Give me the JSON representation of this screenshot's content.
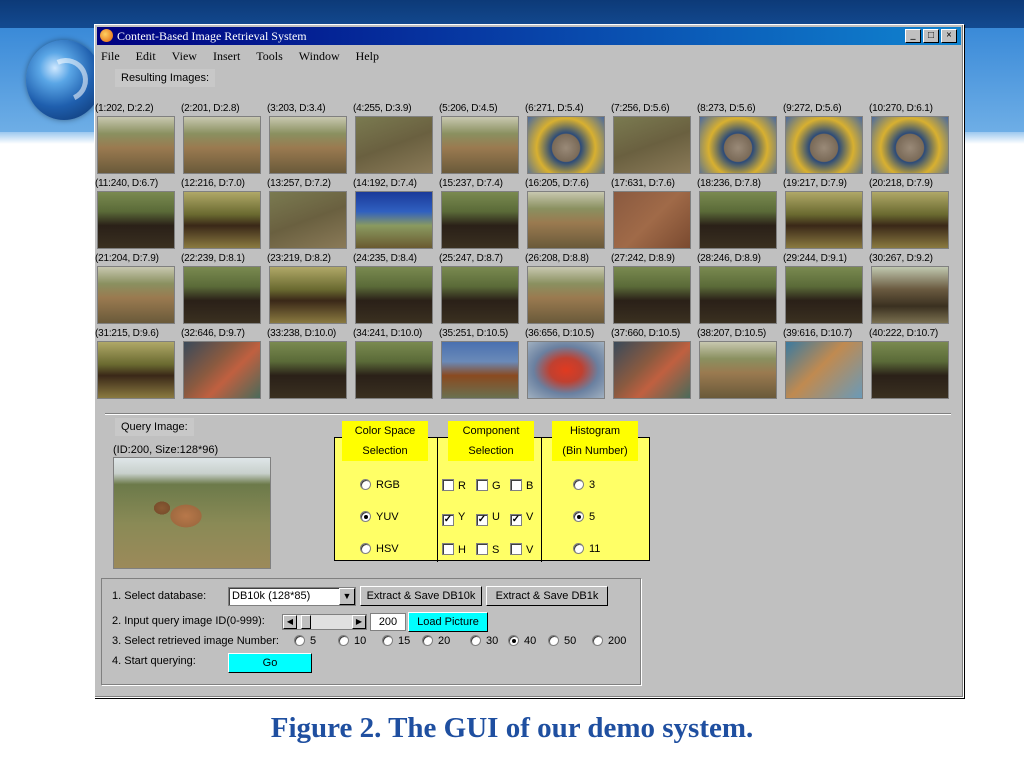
{
  "window": {
    "title": "Content-Based Image Retrieval System",
    "buttons": [
      "_",
      "□",
      "×"
    ]
  },
  "menu": [
    "File",
    "Edit",
    "View",
    "Insert",
    "Tools",
    "Window",
    "Help"
  ],
  "results_label": "Resulting Images:",
  "results": [
    {
      "cap": "(1:202, D:2.2)",
      "tone": "elk"
    },
    {
      "cap": "(2:201, D:2.8)",
      "tone": "elk"
    },
    {
      "cap": "(3:203, D:3.4)",
      "tone": "elk"
    },
    {
      "cap": "(4:255, D:3.9)",
      "tone": "grass"
    },
    {
      "cap": "(5:206, D:4.5)",
      "tone": "elk"
    },
    {
      "cap": "(6:271, D:5.4)",
      "tone": "bird"
    },
    {
      "cap": "(7:256, D:5.6)",
      "tone": "grass"
    },
    {
      "cap": "(8:273, D:5.6)",
      "tone": "bird"
    },
    {
      "cap": "(9:272, D:5.6)",
      "tone": "bird"
    },
    {
      "cap": "(10:270, D:6.1)",
      "tone": "bird"
    },
    {
      "cap": "(11:240, D:6.7)",
      "tone": "bear"
    },
    {
      "cap": "(12:216, D:7.0)",
      "tone": "moose"
    },
    {
      "cap": "(13:257, D:7.2)",
      "tone": "grass"
    },
    {
      "cap": "(14:192, D:7.4)",
      "tone": "sky"
    },
    {
      "cap": "(15:237, D:7.4)",
      "tone": "bear"
    },
    {
      "cap": "(16:205, D:7.6)",
      "tone": "elk"
    },
    {
      "cap": "(17:631, D:7.6)",
      "tone": "aerial"
    },
    {
      "cap": "(18:236, D:7.8)",
      "tone": "bear"
    },
    {
      "cap": "(19:217, D:7.9)",
      "tone": "moose"
    },
    {
      "cap": "(20:218, D:7.9)",
      "tone": "moose"
    },
    {
      "cap": "(21:204, D:7.9)",
      "tone": "elk"
    },
    {
      "cap": "(22:239, D:8.1)",
      "tone": "bear"
    },
    {
      "cap": "(23:219, D:8.2)",
      "tone": "moose"
    },
    {
      "cap": "(24:235, D:8.4)",
      "tone": "bear"
    },
    {
      "cap": "(25:247, D:8.7)",
      "tone": "bear"
    },
    {
      "cap": "(26:208, D:8.8)",
      "tone": "elk"
    },
    {
      "cap": "(27:242, D:8.9)",
      "tone": "bear"
    },
    {
      "cap": "(28:246, D:8.9)",
      "tone": "bear"
    },
    {
      "cap": "(29:244, D:9.1)",
      "tone": "bear"
    },
    {
      "cap": "(30:267, D:9.2)",
      "tone": "owl"
    },
    {
      "cap": "(31:215, D:9.6)",
      "tone": "moose"
    },
    {
      "cap": "(32:646, D:9.7)",
      "tone": "aerial2"
    },
    {
      "cap": "(33:238, D:10.0)",
      "tone": "bear"
    },
    {
      "cap": "(34:241, D:10.0)",
      "tone": "bear"
    },
    {
      "cap": "(35:251, D:10.5)",
      "tone": "horse"
    },
    {
      "cap": "(36:656, D:10.5)",
      "tone": "red"
    },
    {
      "cap": "(37:660, D:10.5)",
      "tone": "aerial2"
    },
    {
      "cap": "(38:207, D:10.5)",
      "tone": "elk"
    },
    {
      "cap": "(39:616, D:10.7)",
      "tone": "water"
    },
    {
      "cap": "(40:222, D:10.7)",
      "tone": "bear"
    }
  ],
  "query": {
    "label": "Query Image:",
    "info": "(ID:200, Size:128*96)"
  },
  "panel": {
    "color_space": {
      "title1": "Color Space",
      "title2": "Selection",
      "options": [
        "RGB",
        "YUV",
        "HSV"
      ],
      "selected": "YUV"
    },
    "component": {
      "title1": "Component",
      "title2": "Selection",
      "rows": [
        [
          {
            "label": "R",
            "checked": false
          },
          {
            "label": "G",
            "checked": false
          },
          {
            "label": "B",
            "checked": false
          }
        ],
        [
          {
            "label": "Y",
            "checked": true
          },
          {
            "label": "U",
            "checked": true
          },
          {
            "label": "V",
            "checked": true
          }
        ],
        [
          {
            "label": "H",
            "checked": false
          },
          {
            "label": "S",
            "checked": false
          },
          {
            "label": "V",
            "checked": false
          }
        ]
      ]
    },
    "histogram": {
      "title1": "Histogram",
      "title2": "(Bin Number)",
      "options": [
        "3",
        "5",
        "11"
      ],
      "selected": "5"
    }
  },
  "controls": {
    "step1": "1. Select database:",
    "database": "DB10k (128*85)",
    "extract_10k": "Extract & Save DB10k",
    "extract_1k": "Extract & Save DB1k",
    "step2": "2. Input query image ID(0-999):",
    "query_id": "200",
    "load": "Load Picture",
    "step3": "3. Select retrieved image Number:",
    "numbers": [
      "5",
      "10",
      "15",
      "20",
      "30",
      "40",
      "50",
      "200"
    ],
    "number_selected": "40",
    "step4": "4. Start querying:",
    "go": "Go"
  },
  "caption": "Figure 2. The GUI of our demo system."
}
